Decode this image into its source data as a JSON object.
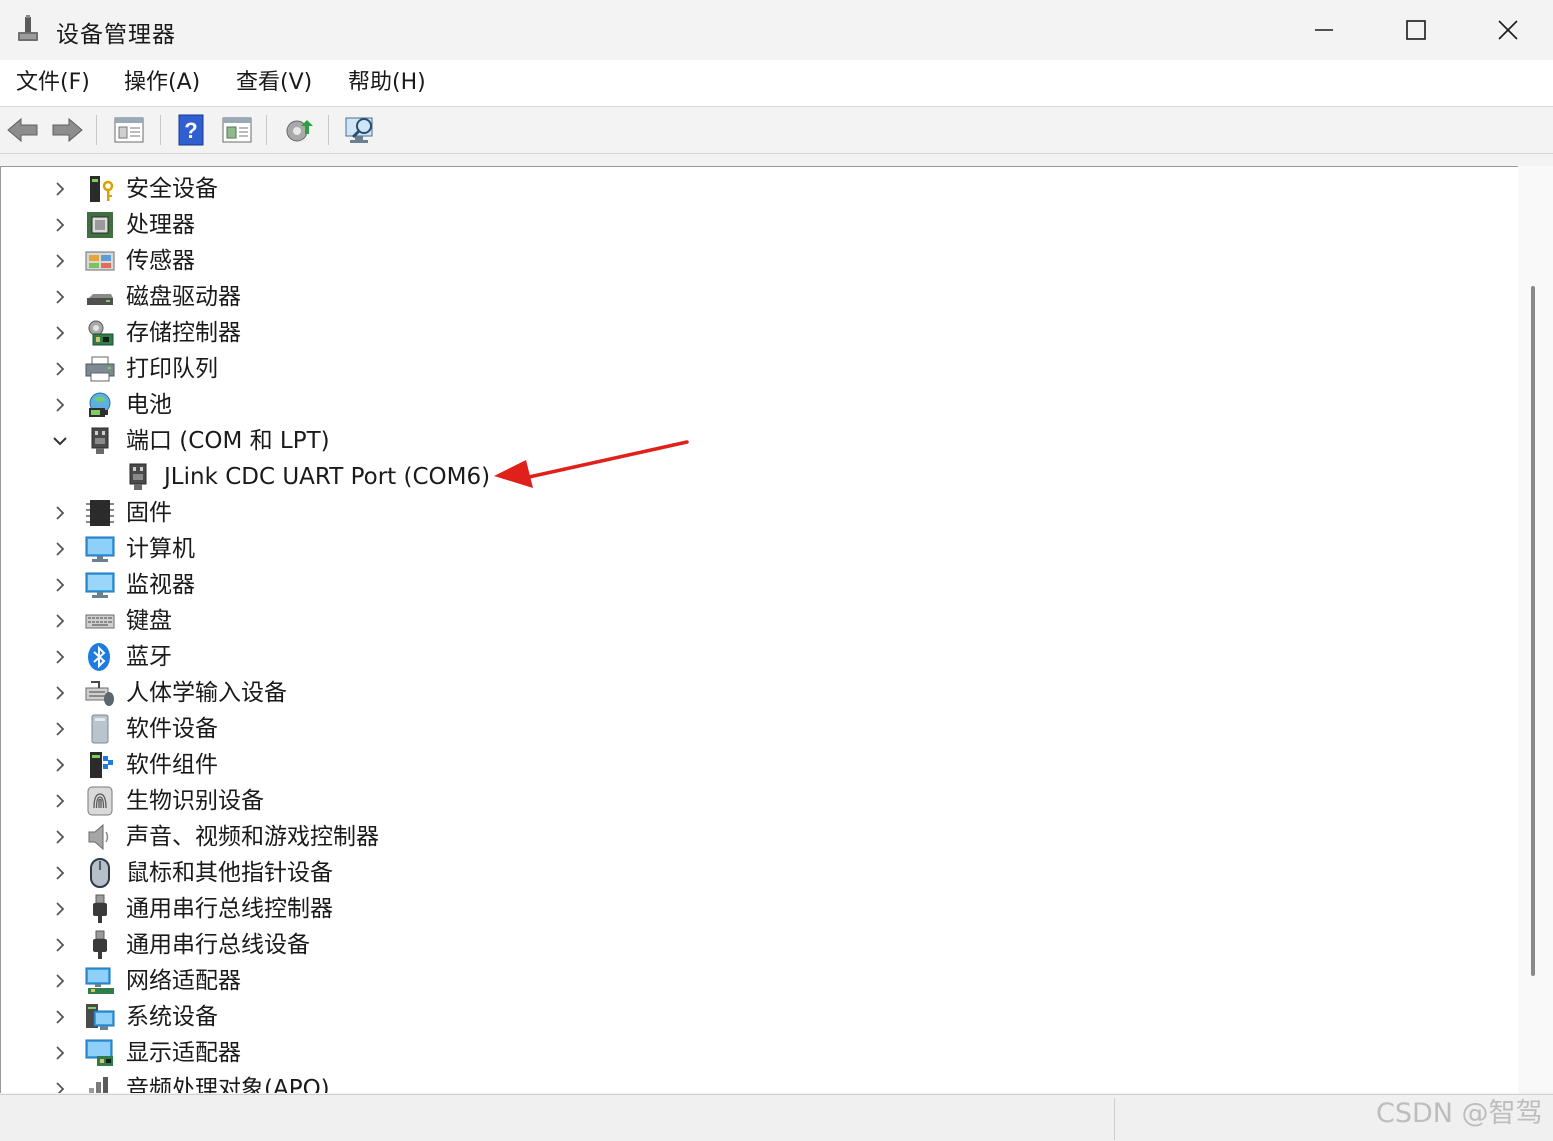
{
  "window": {
    "title": "设备管理器",
    "minimize_icon": "minimize-icon",
    "maximize_icon": "maximize-icon",
    "close_icon": "close-icon"
  },
  "menu": [
    "文件(F)",
    "操作(A)",
    "查看(V)",
    "帮助(H)"
  ],
  "toolbar": {
    "buttons": [
      "back-arrow-icon",
      "forward-arrow-icon",
      "properties-icon",
      "help-icon",
      "view-grid-icon",
      "update-driver-icon",
      "scan-hardware-icon"
    ]
  },
  "tree": {
    "items": [
      {
        "label": "安全设备",
        "icon": "security-key-icon"
      },
      {
        "label": "处理器",
        "icon": "processor-chip-icon"
      },
      {
        "label": "传感器",
        "icon": "sensor-icon"
      },
      {
        "label": "磁盘驱动器",
        "icon": "disk-drive-icon"
      },
      {
        "label": "存储控制器",
        "icon": "storage-controller-icon"
      },
      {
        "label": "打印队列",
        "icon": "printer-icon"
      },
      {
        "label": "电池",
        "icon": "battery-icon"
      },
      {
        "label": "端口 (COM 和 LPT)",
        "icon": "port-connector-icon",
        "expanded": true
      },
      {
        "label": "JLink CDC UART Port (COM6)",
        "icon": "port-connector-icon",
        "child": true
      },
      {
        "label": "固件",
        "icon": "firmware-chip-icon"
      },
      {
        "label": "计算机",
        "icon": "computer-monitor-icon"
      },
      {
        "label": "监视器",
        "icon": "monitor-icon"
      },
      {
        "label": "键盘",
        "icon": "keyboard-icon"
      },
      {
        "label": "蓝牙",
        "icon": "bluetooth-icon"
      },
      {
        "label": "人体学输入设备",
        "icon": "hid-device-icon"
      },
      {
        "label": "软件设备",
        "icon": "software-device-icon"
      },
      {
        "label": "软件组件",
        "icon": "software-component-icon"
      },
      {
        "label": "生物识别设备",
        "icon": "fingerprint-icon"
      },
      {
        "label": "声音、视频和游戏控制器",
        "icon": "speaker-icon"
      },
      {
        "label": "鼠标和其他指针设备",
        "icon": "mouse-icon"
      },
      {
        "label": "通用串行总线控制器",
        "icon": "usb-plug-icon"
      },
      {
        "label": "通用串行总线设备",
        "icon": "usb-plug-icon"
      },
      {
        "label": "网络适配器",
        "icon": "network-adapter-icon"
      },
      {
        "label": "系统设备",
        "icon": "system-device-icon"
      },
      {
        "label": "显示适配器",
        "icon": "display-adapter-icon"
      },
      {
        "label": "音频处理对象(APO)",
        "icon": "audio-processing-icon"
      }
    ]
  },
  "annotation": {
    "color": "#e0201b",
    "icon": "red-arrow-icon"
  },
  "watermark": "CSDN @智驾"
}
